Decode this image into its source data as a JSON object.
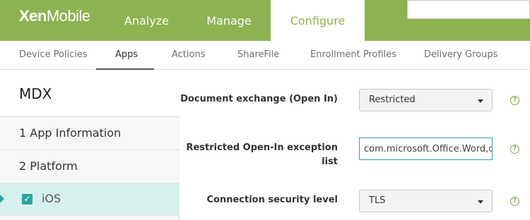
{
  "brand": {
    "bold": "Xen",
    "light": "Mobile"
  },
  "topnav": [
    {
      "label": "Analyze"
    },
    {
      "label": "Manage"
    },
    {
      "label": "Configure",
      "active": true
    }
  ],
  "search": {
    "value": ""
  },
  "subnav": [
    {
      "label": "Device Policies"
    },
    {
      "label": "Apps",
      "active": true
    },
    {
      "label": "Actions"
    },
    {
      "label": "ShareFile"
    },
    {
      "label": "Enrollment Profiles"
    },
    {
      "label": "Delivery Groups"
    }
  ],
  "sidebar": {
    "title": "MDX",
    "items": [
      {
        "label": "1  App Information"
      },
      {
        "label": "2  Platform"
      },
      {
        "label": "iOS",
        "checked": true,
        "selected": true
      }
    ]
  },
  "form": {
    "doc_exchange": {
      "label": "Document exchange (Open In)",
      "value": "Restricted"
    },
    "exception_list": {
      "label_line1": "Restricted Open-In exception",
      "label_line2": "list",
      "value": "com.microsoft.Office.Word,c"
    },
    "security_level": {
      "label": "Connection security level",
      "value": "TLS"
    },
    "help_glyph": "?"
  },
  "colors": {
    "brand_green": "#8cb34f",
    "accent_teal": "#2aa59f",
    "help_green": "#7ab040"
  }
}
